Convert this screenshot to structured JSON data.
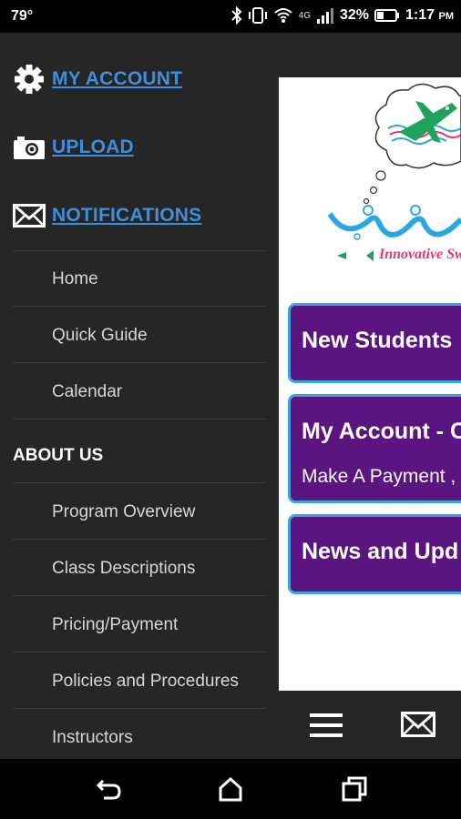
{
  "status_bar": {
    "temperature": "79°",
    "network": "4G",
    "battery": "32%",
    "time": "1:17",
    "ampm": "PM"
  },
  "drawer": {
    "account_links": [
      {
        "label": "MY ACCOUNT",
        "icon": "gear-icon"
      },
      {
        "label": "UPLOAD",
        "icon": "camera-icon"
      },
      {
        "label": "NOTIFICATIONS",
        "icon": "mail-icon"
      }
    ],
    "items": [
      {
        "label": "Home"
      },
      {
        "label": "Quick Guide"
      },
      {
        "label": "Calendar"
      }
    ],
    "about_heading": "ABOUT US",
    "about_items": [
      {
        "label": "Program Overview"
      },
      {
        "label": "Class Descriptions"
      },
      {
        "label": "Pricing/Payment"
      },
      {
        "label": "Policies and Procedures"
      },
      {
        "label": "Instructors"
      }
    ]
  },
  "main": {
    "logo_text": "Innovative Swim",
    "cards": [
      {
        "title": "New Students"
      },
      {
        "title": "My Account - C",
        "subtitle": "Make A Payment ,"
      },
      {
        "title": "News and Upd"
      }
    ]
  },
  "colors": {
    "drawer_bg": "#262626",
    "link": "#3d8fdc",
    "card_bg": "#5a1580",
    "card_border": "#3aa3e0"
  }
}
